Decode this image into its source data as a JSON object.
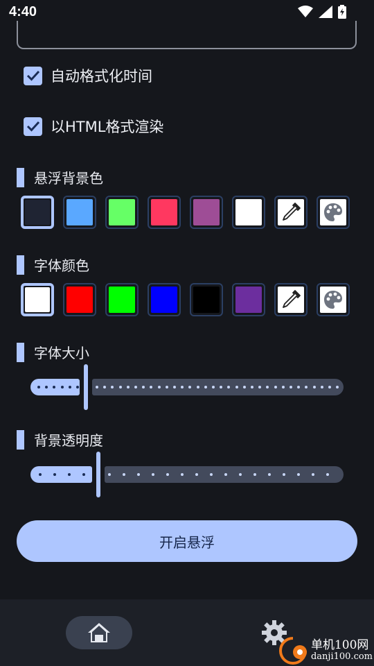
{
  "status_bar": {
    "time": "4:40",
    "icons": [
      "wifi-icon",
      "signal-icon",
      "battery-charging-icon"
    ]
  },
  "options": [
    {
      "label": "自动格式化时间",
      "checked": true
    },
    {
      "label": "以HTML格式渲染",
      "checked": true
    }
  ],
  "background_color": {
    "title": "悬浮背景色",
    "swatches": [
      "#1f2433",
      "#5aa8ff",
      "#66ff66",
      "#ff3860",
      "#9e4d96",
      "#ffffff"
    ],
    "selected_index": 0,
    "tools": [
      "eyedropper-icon",
      "palette-icon"
    ]
  },
  "font_color": {
    "title": "字体颜色",
    "swatches": [
      "#ffffff",
      "#ff0000",
      "#00ff00",
      "#0000ff",
      "#000000",
      "#6c2e9e"
    ],
    "selected_index": 0,
    "tools": [
      "eyedropper-icon",
      "palette-icon"
    ]
  },
  "font_size": {
    "title": "字体大小",
    "level_fraction": 0.17
  },
  "background_opacity": {
    "title": "背景透明度",
    "level_fraction": 0.21
  },
  "start_button": "开启悬浮",
  "bottom_nav": {
    "items": [
      "home-icon",
      "gear-icon"
    ],
    "selected": "home"
  },
  "watermark": {
    "title": "单机100网",
    "url": "danji100.com"
  },
  "colors": {
    "accent": "#aec6ff",
    "background": "#15171c"
  }
}
